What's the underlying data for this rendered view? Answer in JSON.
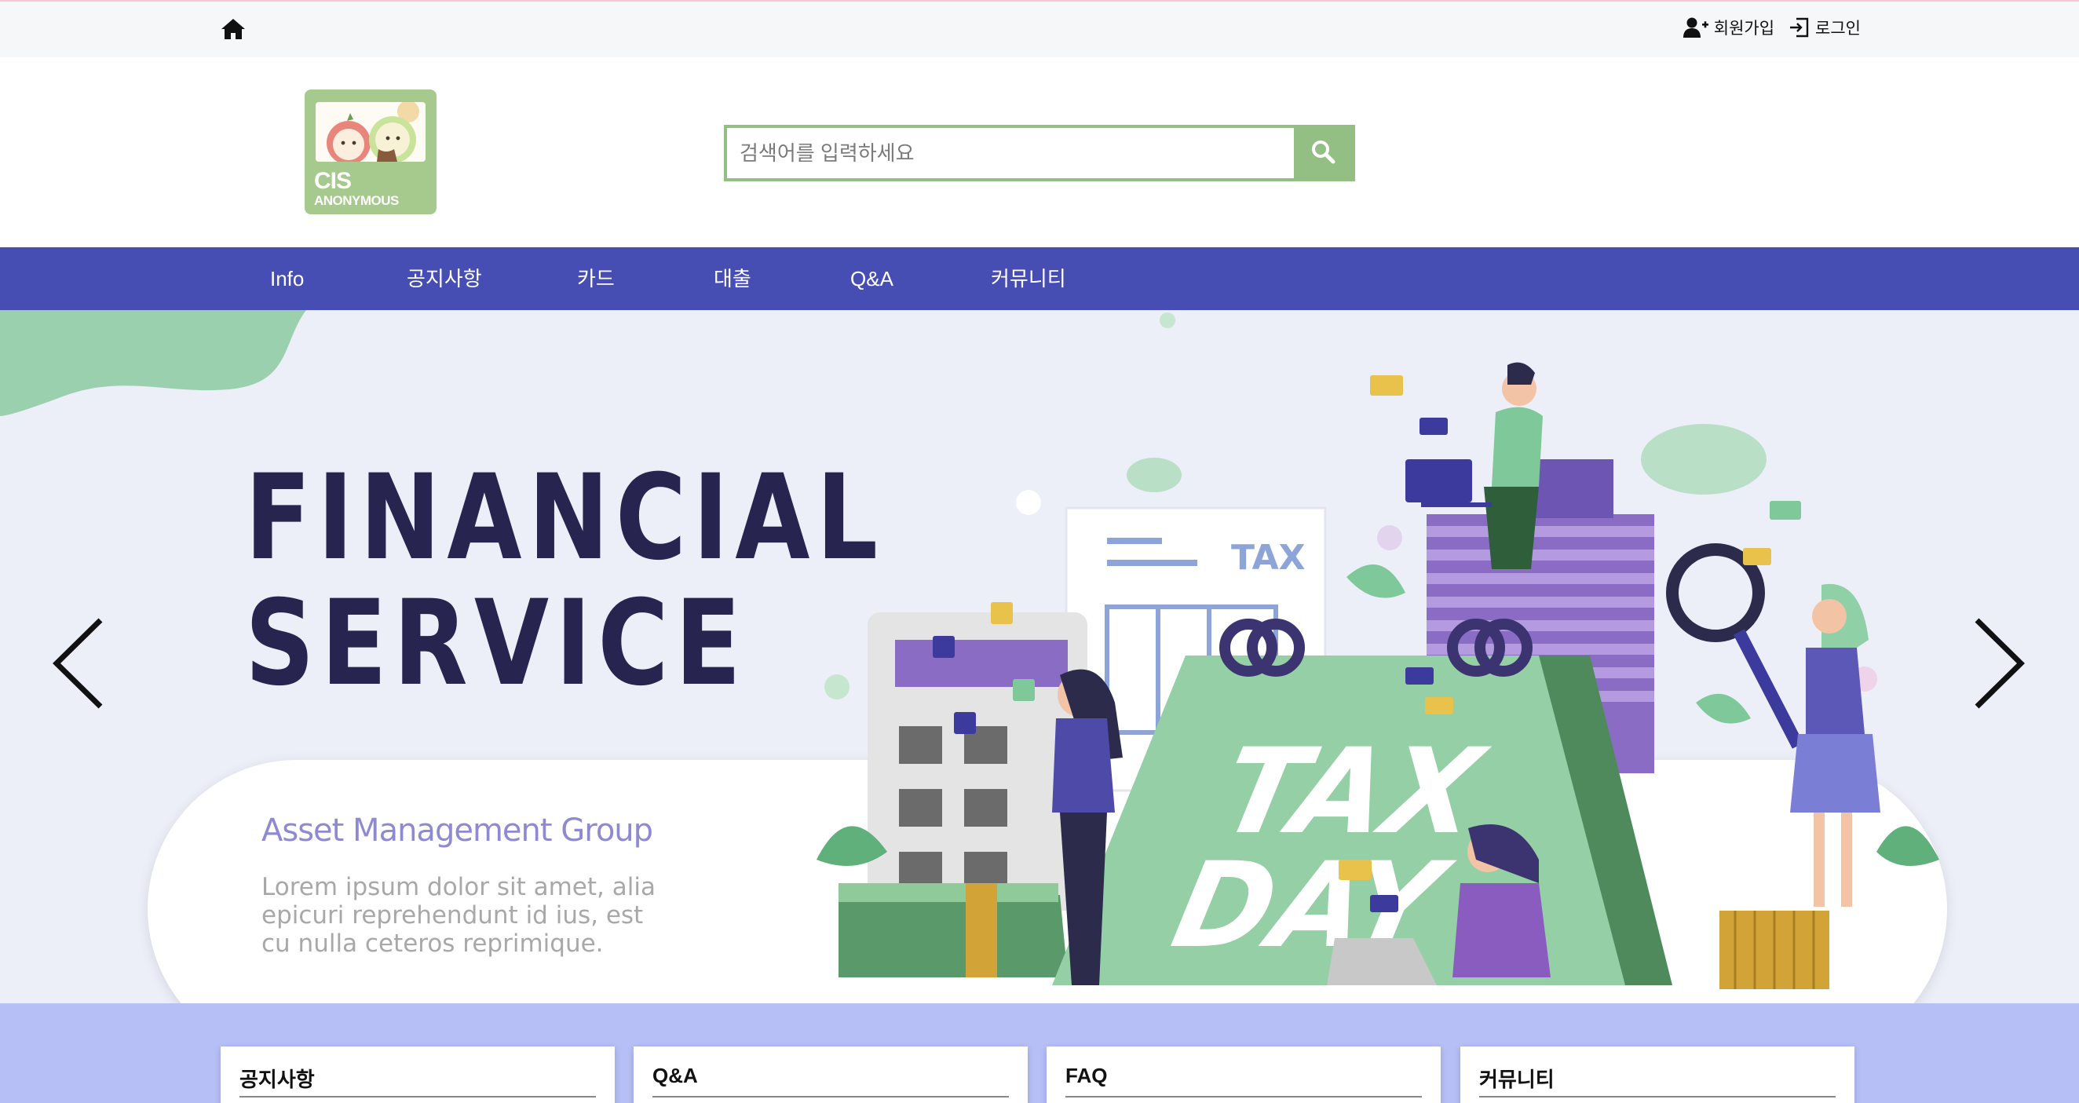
{
  "topbar": {
    "signup_label": "회원가입",
    "login_label": "로그인"
  },
  "header": {
    "logo": {
      "line1": "CIS",
      "line2": "ANONYMOUS"
    },
    "search": {
      "placeholder": "검색어를 입력하세요",
      "value": ""
    }
  },
  "nav": {
    "items": [
      {
        "label": "Info"
      },
      {
        "label": "공지사항"
      },
      {
        "label": "카드"
      },
      {
        "label": "대출"
      },
      {
        "label": "Q&A"
      },
      {
        "label": "커뮤니티"
      }
    ]
  },
  "hero": {
    "title_line1": "FINANCIAL",
    "title_line2": "SERVICE",
    "subtitle": "Asset Management Group",
    "body": "Lorem ipsum dolor sit amet, alia epicuri reprehendunt id ius, est cu nulla ceteros reprimique.",
    "illustration_tax": "TAX",
    "illustration_tax_day_1": "TAX",
    "illustration_tax_day_2": "DAY"
  },
  "cards": [
    {
      "title": "공지사항"
    },
    {
      "title": "Q&A"
    },
    {
      "title": "FAQ"
    },
    {
      "title": "커뮤니티"
    }
  ],
  "colors": {
    "nav_bg": "#464eb3",
    "brand_green": "#93bf85",
    "hero_bg": "#eceef8",
    "title_navy": "#272550",
    "subtitle_purple": "#8d8ad2",
    "cards_bg": "#b6c0f7"
  },
  "icons": {
    "home": "home-icon",
    "signup": "user-plus-icon",
    "login": "sign-in-icon",
    "search": "search-icon",
    "prev": "chevron-left-icon",
    "next": "chevron-right-icon"
  }
}
